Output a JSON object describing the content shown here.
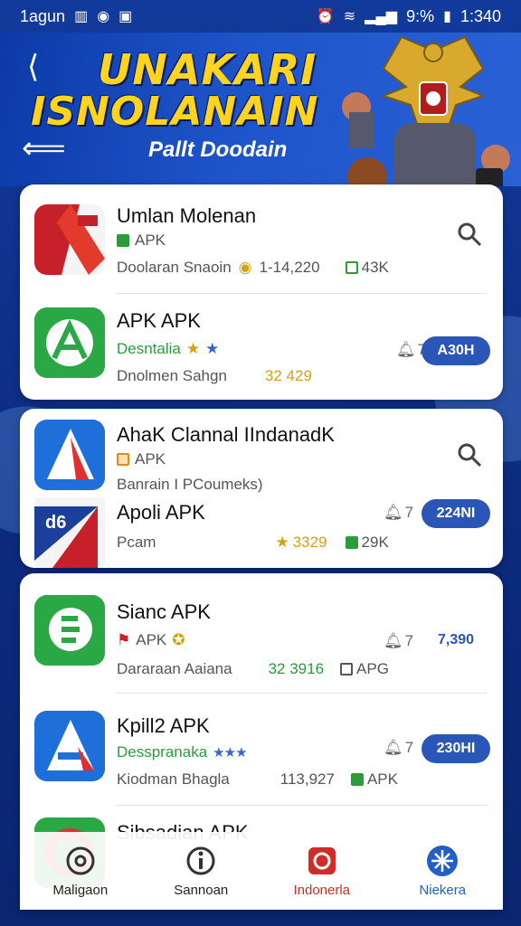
{
  "status_bar": {
    "carrier": "1agun",
    "right_signal": "9:%",
    "time": "1:340"
  },
  "banner": {
    "title_line1": "UNAKARI",
    "title_line2": "ISNOLANAIN",
    "subtitle": "Pallt Doodain"
  },
  "apps": [
    {
      "title": "Umlan Molenan",
      "sub": "APK",
      "meta_left": "Doolaran Snaoin",
      "meta_mid": "1-14,220",
      "meta_right": "43K"
    },
    {
      "title": "APK APK",
      "sub": "Desntalia",
      "meta_left": "Dnolmen Sahgn",
      "meta_mid": "32 429",
      "bell_count": "7",
      "button": "A30H"
    },
    {
      "title": "AhaK Clannal IIndanadK",
      "sub": "APK",
      "meta_left": "Banrain I PCoumeks)"
    },
    {
      "title": "Apoli APK",
      "meta_left": "Pcam",
      "meta_mid": "3329",
      "meta_right": "29K",
      "bell_count": "7",
      "button": "224NI"
    },
    {
      "title": "Sianc APK",
      "sub": "APK",
      "meta_left": "Dararaan Aaiana",
      "meta_mid": "32 3916",
      "meta_right": "APG",
      "bell_count": "7",
      "button": "7,390"
    },
    {
      "title": "Kpill2 APK",
      "sub": "Desspranaka",
      "meta_left": "Kiodman Bhagla",
      "meta_mid": "113,927",
      "meta_right": "APK",
      "bell_count": "7",
      "button": "230HI"
    },
    {
      "title": "Sibsadian APK"
    }
  ],
  "bottom_nav": [
    {
      "label": "Maligaon"
    },
    {
      "label": "Sannoan"
    },
    {
      "label": "Indonerla"
    },
    {
      "label": "Niekera"
    }
  ],
  "colors": {
    "background": "#0f2f86",
    "banner_title": "#ffd41e",
    "button_blue": "#2a56b8",
    "nav_red": "#d32a2a",
    "nav_blue": "#1f5fc7"
  }
}
